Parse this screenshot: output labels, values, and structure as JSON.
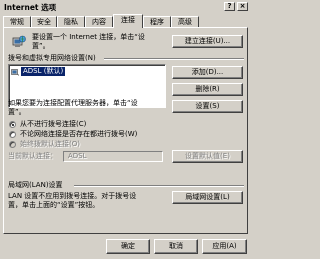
{
  "window": {
    "title": "Internet 选项",
    "help": "?",
    "close": "×"
  },
  "tabs": [
    {
      "label": "常规"
    },
    {
      "label": "安全"
    },
    {
      "label": "隐私"
    },
    {
      "label": "内容"
    },
    {
      "label": "连接"
    },
    {
      "label": "程序"
    },
    {
      "label": "高级"
    }
  ],
  "setup": {
    "line1": "要设置一个 Internet 连接，单击“设",
    "line2": "置”。",
    "button": "建立连接(U)..."
  },
  "dialup": {
    "group_label": "拨号和虚拟专用网络设置(N)",
    "list_item": "ADSL (默认)",
    "add_button": "添加(D)...",
    "remove_button": "删除(R)",
    "settings_button": "设置(S)",
    "proxy_line1": "如果您要为连接配置代理服务器，单击“设",
    "proxy_line2": "置”。",
    "radio_never": "从不进行拨号连接(C)",
    "radio_when_none": "不论网络连接是否存在都进行拨号(W)",
    "radio_always": "始终拨默认连接(O)",
    "current_default_label": "当前默认连接：",
    "current_default_value": "ADSL",
    "set_default_button": "设置默认值(E)"
  },
  "lan": {
    "group_label": "局域网(LAN)设置",
    "line1": "LAN 设置不应用到拨号连接。对于拨号设",
    "line2": "置，单击上面的“设置”按钮。",
    "button": "局域网设置(L)"
  },
  "footer": {
    "ok": "确定",
    "cancel": "取消",
    "apply": "应用(A)"
  }
}
